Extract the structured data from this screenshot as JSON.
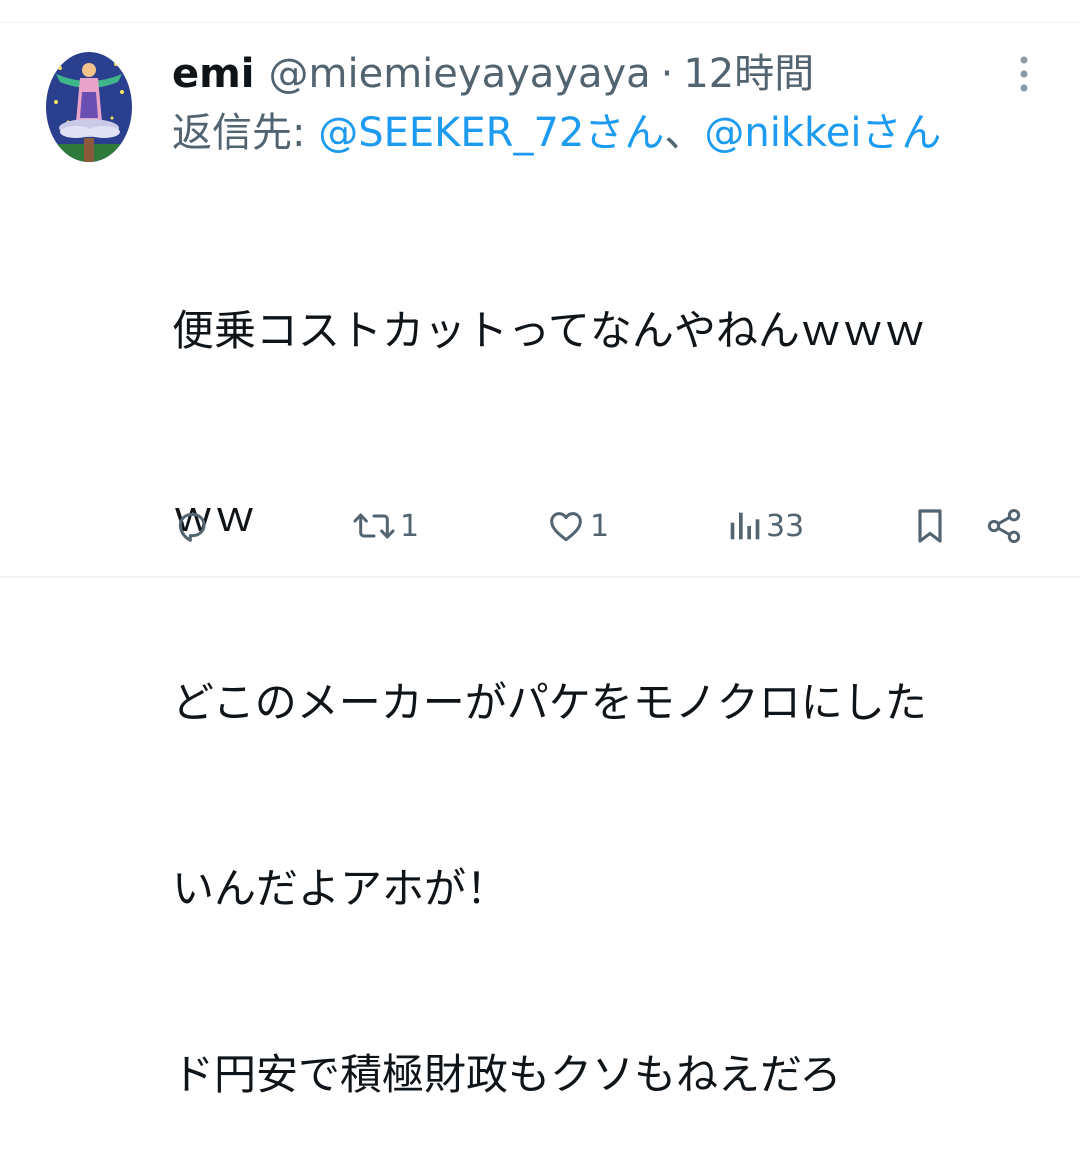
{
  "colors": {
    "text_primary": "#0f1419",
    "text_secondary": "#536471",
    "link": "#1d9bf0",
    "divider": "#eff3f4"
  },
  "tweet": {
    "author": {
      "display_name": "emi",
      "handle": "@miemieyayayaya",
      "separator": "·",
      "time": "12時間",
      "avatar_icon": "avatar-illustration"
    },
    "reply": {
      "prefix": "返信先:",
      "mention_1": "@SEEKER_72さん",
      "separator": "、",
      "mention_2": "@nikkeiさん"
    },
    "text_lines": [
      "便乗コストカットってなんやねんｗｗｗ",
      "ｗｗ",
      "どこのメーカーがパケをモノクロにした",
      "いんだよアホが！",
      "ド円安で積極財政もクソもねえだろ"
    ],
    "actions": {
      "reply_icon": "reply-icon",
      "retweet_icon": "retweet-icon",
      "retweet_count": "1",
      "like_icon": "like-icon",
      "like_count": "1",
      "views_icon": "views-icon",
      "views_count": "33",
      "bookmark_icon": "bookmark-icon",
      "share_icon": "share-icon"
    },
    "more_icon": "more-vertical-icon"
  }
}
